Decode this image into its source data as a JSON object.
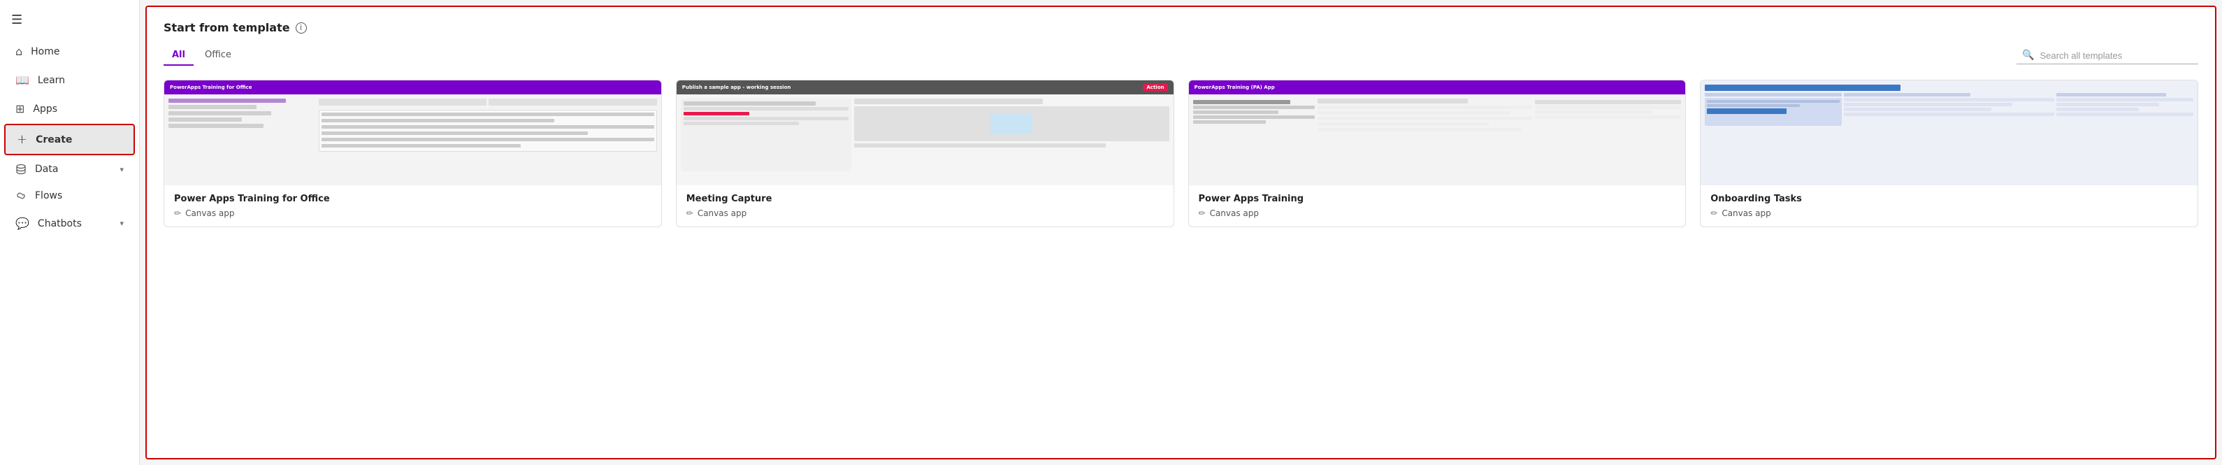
{
  "sidebar": {
    "menu_icon": "☰",
    "items": [
      {
        "id": "home",
        "label": "Home",
        "icon": "home",
        "active": false
      },
      {
        "id": "learn",
        "label": "Learn",
        "icon": "learn",
        "active": false
      },
      {
        "id": "apps",
        "label": "Apps",
        "icon": "apps",
        "active": false
      },
      {
        "id": "create",
        "label": "Create",
        "icon": "create",
        "active": true
      },
      {
        "id": "data",
        "label": "Data",
        "icon": "data",
        "active": false,
        "has_chevron": true
      },
      {
        "id": "flows",
        "label": "Flows",
        "icon": "flows",
        "active": false
      },
      {
        "id": "chatbots",
        "label": "Chatbots",
        "icon": "chatbots",
        "active": false,
        "has_chevron": true
      }
    ]
  },
  "template_section": {
    "title": "Start from template",
    "info_icon": "ⓘ",
    "tabs": [
      {
        "id": "all",
        "label": "All",
        "active": true
      },
      {
        "id": "office",
        "label": "Office",
        "active": false
      }
    ],
    "search": {
      "placeholder": "Search all templates",
      "icon": "🔍"
    },
    "cards": [
      {
        "id": "card1",
        "title": "Power Apps Training for Office",
        "type": "Canvas app",
        "thumb_color": "#7a00cc"
      },
      {
        "id": "card2",
        "title": "Meeting Capture",
        "type": "Canvas app",
        "thumb_color": "#e8194c"
      },
      {
        "id": "card3",
        "title": "Power Apps Training",
        "type": "Canvas app",
        "thumb_color": "#7a00cc"
      },
      {
        "id": "card4",
        "title": "Onboarding Tasks",
        "type": "Canvas app",
        "thumb_color": "#3b78c3"
      }
    ]
  }
}
